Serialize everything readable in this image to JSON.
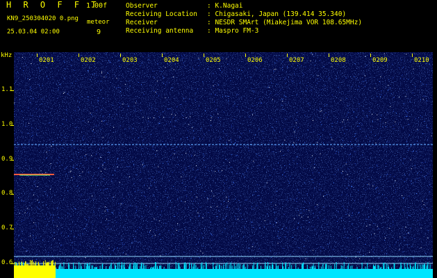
{
  "header": {
    "app_title": "H R O F F T",
    "version": "1.00f",
    "file_name": "KN9_250304020 0.png",
    "datetime": "25.03.04 02:00",
    "meteor_label": "meteor",
    "meteor_count": "9"
  },
  "info": [
    {
      "label": "Observer",
      "value": ": K.Nagai"
    },
    {
      "label": "Receiving Location",
      "value": ": Chigasaki, Japan (139.414 35.340)"
    },
    {
      "label": "Receiver",
      "value": ": NESDR SMArt (Miakejima VOR 108.65MHz)"
    },
    {
      "label": "Receiving antenna",
      "value": ": Maspro FM-3"
    }
  ],
  "axis": {
    "unit": "kHz",
    "y_ticks": [
      "1.1",
      "1.0",
      "0.9",
      "0.8",
      "0.7",
      "0.6"
    ],
    "x_ticks": [
      "0201",
      "0202",
      "0203",
      "0204",
      "0205",
      "0206",
      "0207",
      "0208",
      "0209",
      "0210"
    ]
  },
  "colors": {
    "background": "#000000",
    "text": "#ffff00",
    "spectrum_bg": "#030a46",
    "noise_floor": "#00ffff",
    "signal": "#ffff00"
  }
}
